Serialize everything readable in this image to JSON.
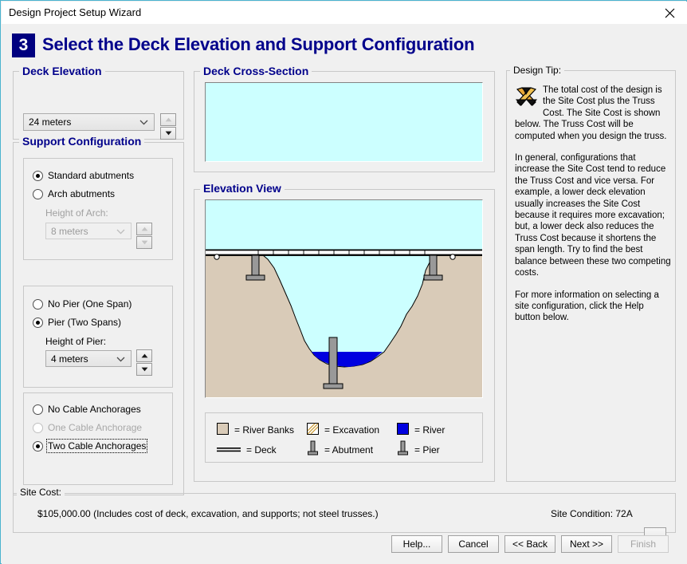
{
  "window": {
    "title": "Design Project Setup Wizard",
    "close_icon": "close-icon"
  },
  "header": {
    "step_number": "3",
    "title": "Select the Deck Elevation and Support Configuration"
  },
  "deck_elevation": {
    "legend": "Deck Elevation",
    "value": "24 meters",
    "spinner_up": "▲",
    "spinner_down": "▼"
  },
  "support_configuration": {
    "legend": "Support Configuration",
    "abutments": {
      "options": [
        {
          "label": "Standard abutments",
          "selected": true,
          "disabled": false
        },
        {
          "label": "Arch abutments",
          "selected": false,
          "disabled": false
        }
      ],
      "height_label": "Height of Arch:",
      "height_value": "8 meters",
      "height_disabled": true
    },
    "piers": {
      "options": [
        {
          "label": "No Pier (One Span)",
          "selected": false,
          "disabled": false
        },
        {
          "label": "Pier (Two Spans)",
          "selected": true,
          "disabled": false
        }
      ],
      "height_label": "Height of Pier:",
      "height_value": "4 meters",
      "height_disabled": false
    },
    "anchorages": {
      "options": [
        {
          "label": "No Cable Anchorages",
          "selected": false,
          "disabled": false
        },
        {
          "label": "One Cable Anchorage",
          "selected": false,
          "disabled": true
        },
        {
          "label": "Two Cable Anchorages",
          "selected": true,
          "disabled": false,
          "focused": true
        }
      ]
    }
  },
  "deck_cross_section": {
    "legend": "Deck Cross-Section"
  },
  "elevation_view": {
    "legend": "Elevation View"
  },
  "diagram_legend": {
    "items": [
      {
        "key": "river-banks",
        "label": "= River Banks",
        "swatch": "fill"
      },
      {
        "key": "excavation",
        "label": "= Excavation",
        "swatch": "hatch"
      },
      {
        "key": "river",
        "label": "= River",
        "swatch": "river"
      },
      {
        "key": "deck",
        "label": "= Deck",
        "swatch": "deck"
      },
      {
        "key": "abutment",
        "label": "= Abutment",
        "swatch": "abutment"
      },
      {
        "key": "pier",
        "label": "= Pier",
        "swatch": "pier"
      }
    ]
  },
  "design_tip": {
    "legend": "Design Tip:",
    "icon": "drafting-compass-icon",
    "paragraphs": [
      "The total cost of the design is the Site Cost plus the Truss Cost. The Site Cost is shown below. The Truss Cost will be computed when you design the truss.",
      "In general, configurations that increase the Site Cost tend to reduce the Truss Cost and vice versa. For example, a lower deck elevation usually increases the Site Cost because it requires more excavation; but, a lower deck also reduces the Truss Cost because it shortens the span length. Try to find the best balance between these two competing costs.",
      "For more information on selecting a site configuration, click the Help button below."
    ]
  },
  "site_cost": {
    "legend": "Site Cost:",
    "value": "$105,000.00  (Includes cost of deck, excavation, and supports; not steel trusses.)",
    "site_condition": "Site Condition: 72A",
    "dropdown_icon": "▼"
  },
  "footer_buttons": [
    {
      "key": "help",
      "label": "Help...",
      "disabled": false
    },
    {
      "key": "cancel",
      "label": "Cancel",
      "disabled": false
    },
    {
      "key": "back",
      "label": "<< Back",
      "disabled": false
    },
    {
      "key": "next",
      "label": "Next >>",
      "disabled": false
    },
    {
      "key": "finish",
      "label": "Finish",
      "disabled": true
    }
  ],
  "colors": {
    "sky": "#ccffff",
    "banks": "#d9cbb8",
    "river": "#0000e0",
    "support": "#999999",
    "header_blue": "#00008b",
    "badge_blue": "#00007f",
    "window_border": "#4ab3cf"
  }
}
